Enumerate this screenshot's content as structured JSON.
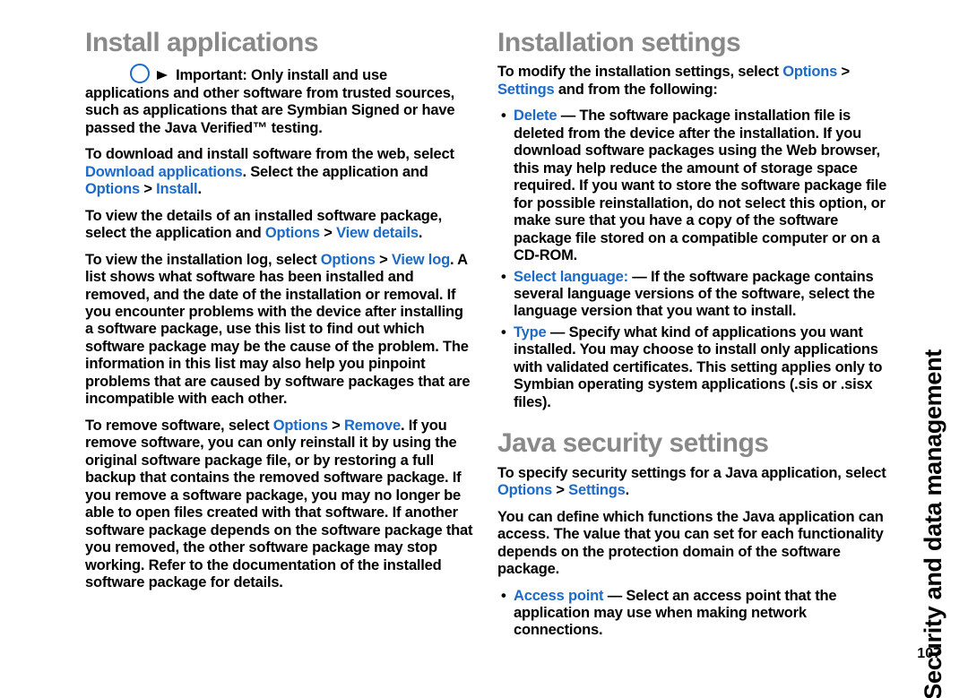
{
  "sideTitle": "Security and data management",
  "pageNumber": "107",
  "left": {
    "heading": "Install applications",
    "importantLabel": "Important:",
    "importantText": "  Only install and use applications and other software from trusted sources, such as applications that are Symbian Signed or have passed the Java Verified™ testing.",
    "p2a": "To download and install software from the web, select ",
    "p2b": "Download applications",
    "p2c": ". Select the application and ",
    "p2d": "Options",
    "p2e": " > ",
    "p2f": "Install",
    "p2g": ".",
    "p3a": "To view the details of an installed software package, select the application and ",
    "p3b": "Options",
    "p3c": " > ",
    "p3d": "View details",
    "p3e": ".",
    "p4a": "To view the installation log, select ",
    "p4b": "Options",
    "p4c": " > ",
    "p4d": "View log",
    "p4e": ". A list shows what software has been installed and removed, and the date of the installation or removal. If you encounter problems with the device after installing a software package, use this list to find out which software package may be the cause of the problem. The information in this list may also help you pinpoint problems that are caused by software packages that are incompatible with each other.",
    "p5a": "To remove software, select ",
    "p5b": "Options",
    "p5c": " > ",
    "p5d": "Remove",
    "p5e": ". If you remove software, you can only reinstall it by using the original software package file, or by restoring a full backup that contains the removed software package. If you remove a software package, you may no longer be able to open files created with that software. If another software package depends on the software package that you removed, the other software package may stop working. Refer to the documentation of the installed software package for details."
  },
  "right": {
    "heading1": "Installation settings",
    "intro1a": "To modify the installation settings, select ",
    "intro1b": "Options",
    "intro1c": " > ",
    "intro1d": "Settings",
    "intro1e": " and from the following:",
    "li1a": "Delete",
    "li1b": " — The software package installation file is deleted from the device after the installation. If you download software packages using the Web browser, this may help reduce the amount of storage space required. If you want to store the software package file for possible reinstallation, do not select this option, or make sure that you have a copy of the software package file stored on a compatible computer or on a CD-ROM.",
    "li2a": "Select language:",
    "li2b": " — If the software package contains several language versions of the software, select the language version that you want to install.",
    "li3a": "Type",
    "li3b": " — Specify what kind of applications you want installed. You may choose to install only applications with validated certificates. This setting applies only to Symbian operating system applications (.sis or .sisx files).",
    "heading2": "Java security settings",
    "intro2a": "To specify security settings for a Java application, select ",
    "intro2b": "Options",
    "intro2c": " > ",
    "intro2d": "Settings",
    "intro2e": ".",
    "p2": "You can define which functions the Java application can access. The value that you can set for each functionality depends on the protection domain of the software package.",
    "li4a": "Access point",
    "li4b": " — Select an access point that the application may use when making network connections."
  }
}
